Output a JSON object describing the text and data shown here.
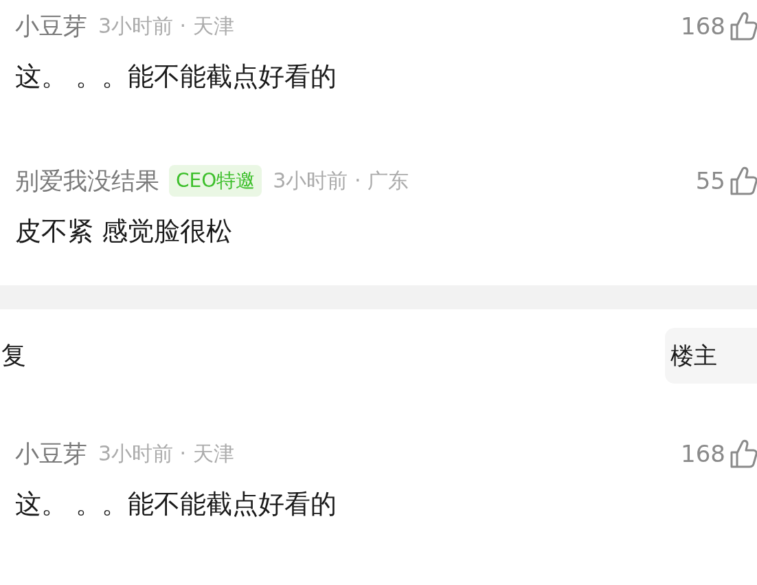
{
  "comments_top": [
    {
      "author": "小豆芽",
      "meta": "3小时前 · 天津",
      "likes": "168",
      "text": "这。 。。能不能截点好看的"
    },
    {
      "author": "别爱我没结果",
      "badge": "CEO特邀",
      "meta": "3小时前 · 广东",
      "likes": "55",
      "text": "皮不紧 感觉脸很松"
    }
  ],
  "reply_header": {
    "label": "复",
    "filter_button": "楼主"
  },
  "comments_bottom": [
    {
      "author": "小豆芽",
      "meta": "3小时前 · 天津",
      "likes": "168",
      "text": "这。 。。能不能截点好看的"
    }
  ]
}
